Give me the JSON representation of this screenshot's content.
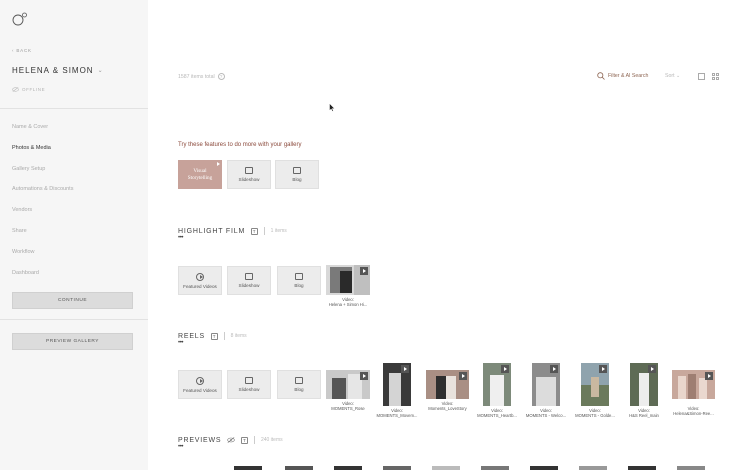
{
  "sidebar": {
    "back_label": "BACK",
    "gallery_name": "HELENA & SIMON",
    "status": "OFFLINE",
    "nav": [
      {
        "label": "Name & Cover",
        "active": false
      },
      {
        "label": "Photos & Media",
        "active": true
      },
      {
        "label": "Gallery Setup",
        "active": false
      },
      {
        "label": "Automations & Discounts",
        "active": false
      },
      {
        "label": "Vendors",
        "active": false
      },
      {
        "label": "Share",
        "active": false
      },
      {
        "label": "Workflow",
        "active": false
      },
      {
        "label": "Dashboard",
        "active": false
      }
    ],
    "continue_label": "CONTINUE",
    "preview_label": "PREVIEW GALLERY"
  },
  "toolbar": {
    "items_total": "1587 items total",
    "help": "?",
    "filter_label": "Filter & AI Search",
    "sort_label": "Sort"
  },
  "promo": {
    "title": "Try these features to do more with your gallery",
    "storytelling": "Visual Storytelling",
    "slideshow": "Slideshow",
    "blog": "Blog"
  },
  "highlight": {
    "title": "HIGHLIGHT FILM",
    "tag": "T",
    "count": "1 items",
    "featured": "Featured Videos",
    "slideshow": "Slideshow",
    "blog": "Blog",
    "videos": [
      {
        "line1": "Video:",
        "line2": "Helena + Simon Hi..."
      }
    ]
  },
  "reels": {
    "title": "REELS",
    "tag": "T",
    "count": "8 items",
    "featured": "Featured Videos",
    "slideshow": "Slideshow",
    "blog": "Blog",
    "videos": [
      {
        "line1": "Video:",
        "line2": "MOMENTS_Rose"
      },
      {
        "line1": "Video:",
        "line2": "MOMENTS_Movem..."
      },
      {
        "line1": "Video:",
        "line2": "Moments_LoveStory"
      },
      {
        "line1": "Video:",
        "line2": "MOMENTS_Heartb..."
      },
      {
        "line1": "Video:",
        "line2": "MOMENTS - Welco..."
      },
      {
        "line1": "Video:",
        "line2": "MOMENTS - Golde..."
      },
      {
        "line1": "Video:",
        "line2": "H&S Reel_main"
      },
      {
        "line1": "Video:",
        "line2": "Helena&Simon-Ree..."
      }
    ]
  },
  "previews": {
    "title": "PREVIEWS",
    "tag": "T",
    "count": "240 items"
  },
  "colors": {
    "accent": "#8b4a3c",
    "storytelling_bg": "#c7a29a",
    "sidebar_bg": "#f6f6f6"
  }
}
